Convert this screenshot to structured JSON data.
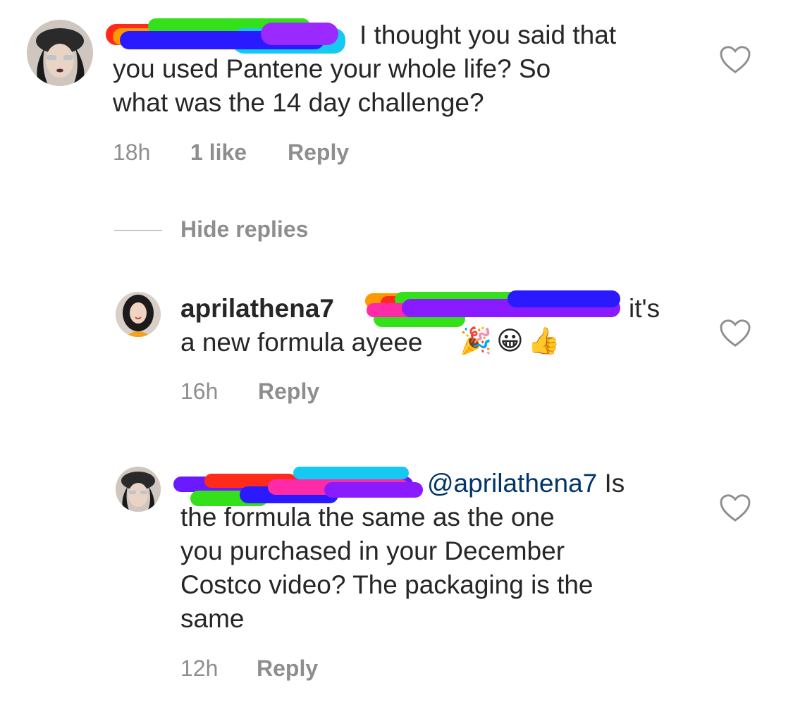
{
  "comments": [
    {
      "text_line1": "I thought you said that",
      "text_line2": "you used Pantene your whole life? So",
      "text_line3": "what was the 14 day challenge?",
      "time": "18h",
      "likes": "1 like",
      "reply_label": "Reply"
    }
  ],
  "hide_replies_label": "Hide replies",
  "replies": [
    {
      "username": "aprilathena7",
      "text_end1": "it's",
      "text_line2": "a new formula ayeee",
      "emojis": "🎉😀👍",
      "time": "16h",
      "reply_label": "Reply"
    },
    {
      "mention": "@aprilathena7",
      "text_end1": "Is",
      "text_line2": "the formula the same as the one",
      "text_line3": "you purchased in your December",
      "text_line4": "Costco video? The packaging is the",
      "text_line5": "same",
      "time": "12h",
      "reply_label": "Reply"
    }
  ],
  "colors": {
    "text": "#262626",
    "meta": "#8e8e8e",
    "mention": "#003569",
    "divider": "#c7c7c7"
  },
  "icons": [
    "heart-outline-icon",
    "avatar-commenter",
    "avatar-aprilathena7"
  ]
}
